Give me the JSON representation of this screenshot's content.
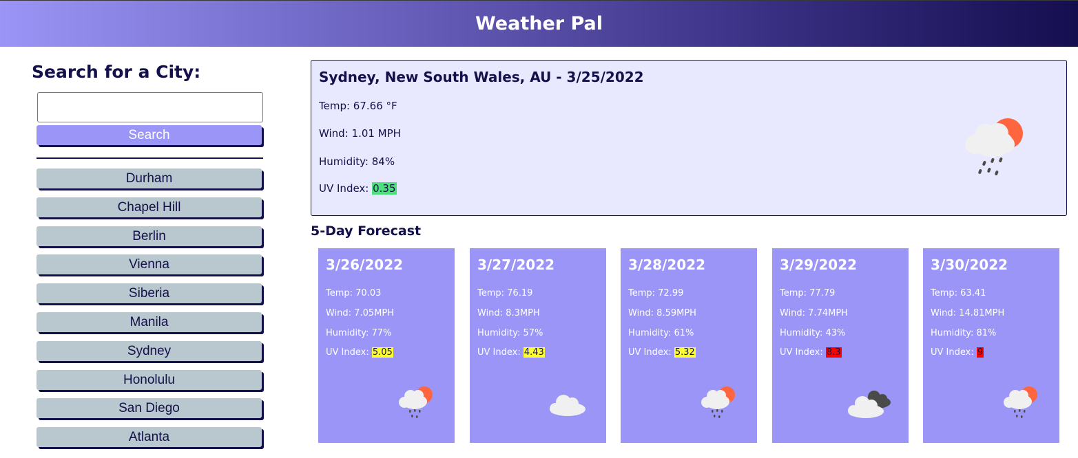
{
  "app": {
    "title": "Weather Pal"
  },
  "search": {
    "title": "Search for a City:",
    "input_value": "",
    "button_label": "Search"
  },
  "history": [
    "Durham",
    "Chapel Hill",
    "Berlin",
    "Vienna",
    "Siberia",
    "Manila",
    "Sydney",
    "Honolulu",
    "San Diego",
    "Atlanta"
  ],
  "current": {
    "heading": "Sydney, New South Wales, AU - 3/25/2022",
    "temp": "Temp: 67.66 °F",
    "wind": "Wind: 1.01 MPH",
    "humidity": "Humidity: 84%",
    "uv_label": "UV Index: ",
    "uv_value": "0.35",
    "uv_color": "#4ee07a",
    "icon": "sun-cloud-rain-icon"
  },
  "forecast": {
    "title": "5-Day Forecast",
    "days": [
      {
        "date": "3/26/2022",
        "temp": "Temp: 70.03",
        "wind": "Wind: 7.05MPH",
        "humidity": "Humidity: 77%",
        "uv_label": "UV Index: ",
        "uv_value": "5.05",
        "uv_color": "#ffff33",
        "icon": "sun-cloud-rain-icon"
      },
      {
        "date": "3/27/2022",
        "temp": "Temp: 76.19",
        "wind": "Wind: 8.3MPH",
        "humidity": "Humidity: 57%",
        "uv_label": "UV Index: ",
        "uv_value": "4.43",
        "uv_color": "#ffff33",
        "icon": "cloud-icon"
      },
      {
        "date": "3/28/2022",
        "temp": "Temp: 72.99",
        "wind": "Wind: 8.59MPH",
        "humidity": "Humidity: 61%",
        "uv_label": "UV Index: ",
        "uv_value": "5.32",
        "uv_color": "#ffff33",
        "icon": "sun-cloud-rain-icon"
      },
      {
        "date": "3/29/2022",
        "temp": "Temp: 77.79",
        "wind": "Wind: 7.74MPH",
        "humidity": "Humidity: 43%",
        "uv_label": "UV Index: ",
        "uv_value": "8.3",
        "uv_color": "#ff0000",
        "icon": "broken-clouds-icon"
      },
      {
        "date": "3/30/2022",
        "temp": "Temp: 63.41",
        "wind": "Wind: 14.81MPH",
        "humidity": "Humidity: 81%",
        "uv_label": "UV Index: ",
        "uv_value": "9",
        "uv_color": "#ff0000",
        "icon": "sun-cloud-rain-icon"
      }
    ]
  }
}
